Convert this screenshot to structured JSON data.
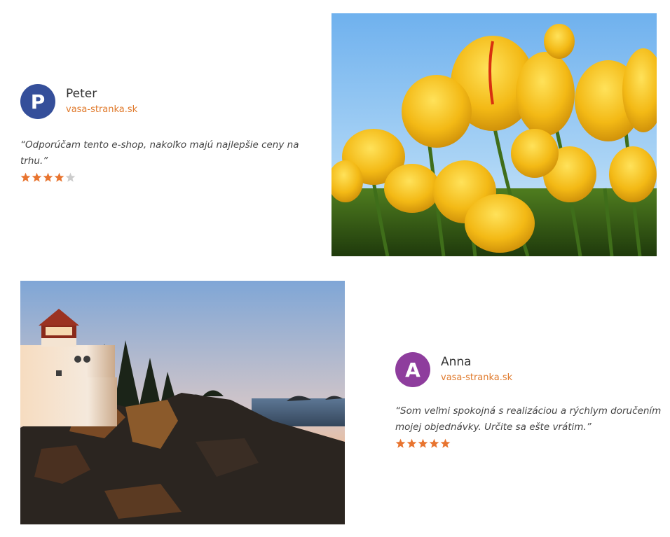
{
  "colors": {
    "accent": "#e07a2c",
    "star_filled": "#e8742f",
    "star_empty": "#cccccc"
  },
  "testimonials": [
    {
      "avatar_letter": "P",
      "avatar_color": "#354f9a",
      "name": "Peter",
      "site": "vasa-stranka.sk",
      "quote": "“Odporúčam tento e-shop, nakoľko majú najlepšie ceny na trhu.”",
      "rating": 4,
      "rating_max": 5
    },
    {
      "avatar_letter": "A",
      "avatar_color": "#8e3d9d",
      "name": "Anna",
      "site": "vasa-stranka.sk",
      "quote": "“Som veľmi spokojná s realizáciou a rýchlym doručením mojej objednávky. Určite sa ešte vrátim.”",
      "rating": 5,
      "rating_max": 5
    }
  ],
  "images": {
    "first": "yellow-tulips-photo",
    "second": "lighthouse-sunset-photo"
  }
}
